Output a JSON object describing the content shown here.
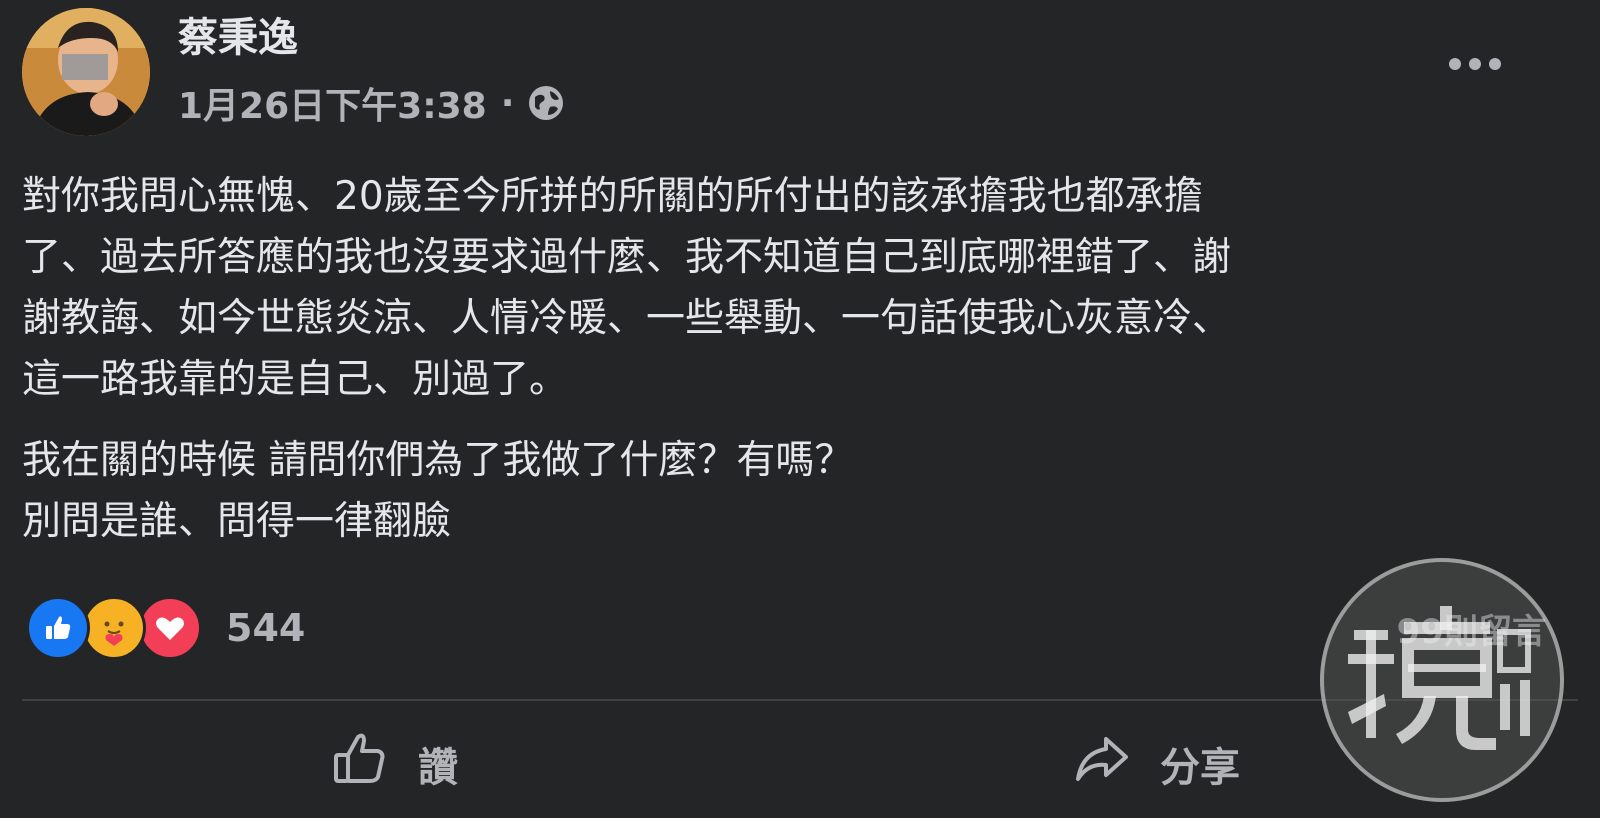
{
  "post": {
    "author": "蔡秉逸",
    "timestamp": "1月26日下午3:38",
    "separator": "·",
    "privacy_icon": "globe-icon",
    "paragraphs": [
      "對你我問心無愧、20歲至今所拼的所關的所付出的該承擔我也都承擔\n了、過去所答應的我也沒要求過什麼、我不知道自己到底哪裡錯了、謝\n謝教誨、如今世態炎涼、人情冷暖、一些舉動、一句話使我心灰意冷、\n這一路我靠的是自己、別過了。",
      "我在關的時候 請問你們為了我做了什麼？有嗎？\n別問是誰、問得一律翻臉"
    ]
  },
  "reactions": {
    "icons": [
      "like-icon",
      "care-icon",
      "love-icon"
    ],
    "count": "544"
  },
  "comments": {
    "count_label": "99則留言"
  },
  "actions": {
    "like_label": "讚",
    "share_label": "分享"
  },
  "watermark": {
    "text": "鏡週刊"
  },
  "colors": {
    "background": "#242526",
    "primary_text": "#e4e6eb",
    "secondary_text": "#b0b3b8",
    "like_blue": "#1877f2",
    "love_red": "#f33e58",
    "care_yellow": "#f7b125"
  }
}
